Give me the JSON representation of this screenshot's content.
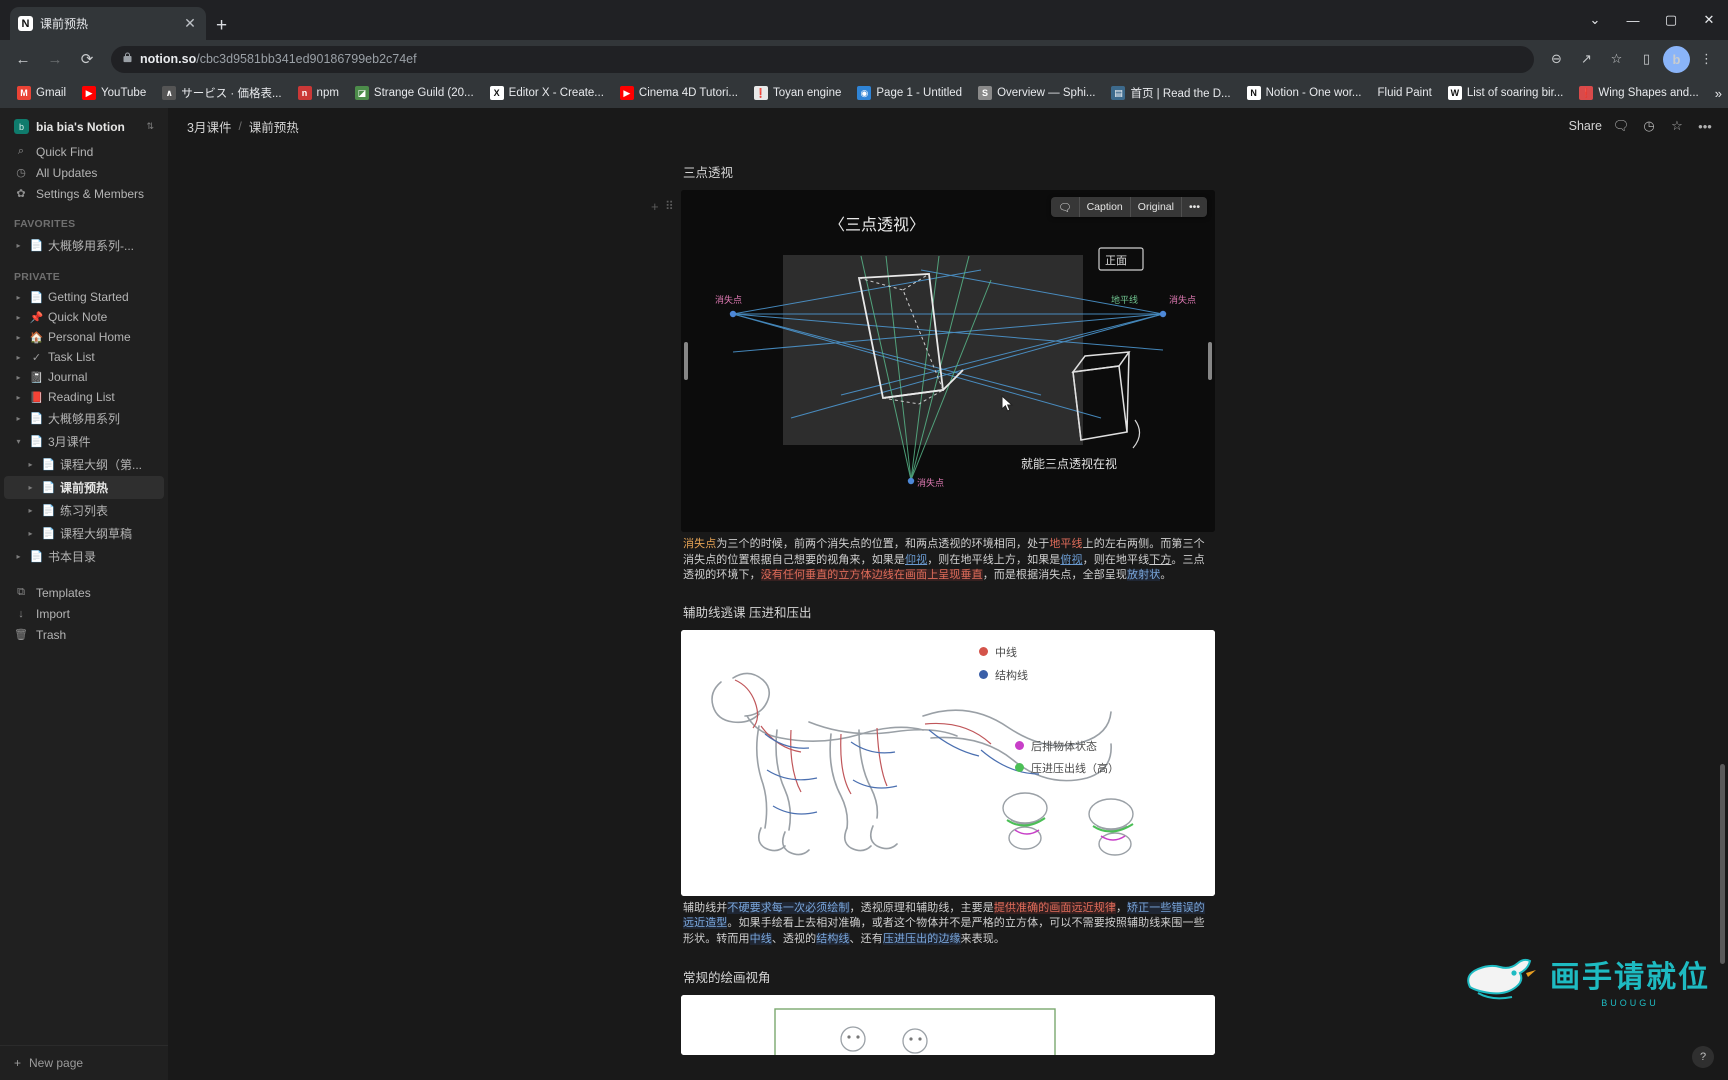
{
  "browser": {
    "tab": {
      "title": "课前预热",
      "favicon": "N",
      "close_label": "✕"
    },
    "new_tab_label": "+",
    "window_controls": {
      "minimize": "—",
      "maximize": "▢",
      "close": "✕",
      "chevron": "⌄"
    },
    "nav": {
      "back": "←",
      "forward": "→",
      "reload": "⟳"
    },
    "omnibox": {
      "lock_icon": "🔒",
      "url_domain": "notion.so",
      "url_path": "/cbc3d9581bb341ed90186799eb2c74ef"
    },
    "toolbar_icons": {
      "zoom": "⊖",
      "share": "↗",
      "star": "☆",
      "sidepanel": "▯",
      "menu": "⋮"
    },
    "profile_initial": "b",
    "bookmarks": [
      {
        "label": "Gmail",
        "icon": "M",
        "color": "#ea4335"
      },
      {
        "label": "YouTube",
        "icon": "▶",
        "color": "#ff0000"
      },
      {
        "label": "サービス · 価格表...",
        "icon": "∧",
        "color": "#555555"
      },
      {
        "label": "npm",
        "icon": "n",
        "color": "#cb3837"
      },
      {
        "label": "Strange Guild (20...",
        "icon": "◪",
        "color": "#4c8c4a"
      },
      {
        "label": "Editor X - Create...",
        "icon": "X",
        "color": "#ffffff"
      },
      {
        "label": "Cinema 4D Tutori...",
        "icon": "▶",
        "color": "#ff0000"
      },
      {
        "label": "Toyan engine",
        "icon": "❗",
        "color": "#e8e8e8"
      },
      {
        "label": "Page 1 - Untitled",
        "icon": "◉",
        "color": "#2f84d6"
      },
      {
        "label": "Overview — Sphi...",
        "icon": "S",
        "color": "#8a8a8a"
      },
      {
        "label": "首页 | Read the D...",
        "icon": "▤",
        "color": "#3d6a8c"
      },
      {
        "label": "Notion - One wor...",
        "icon": "N",
        "color": "#ffffff"
      },
      {
        "label": "Fluid Paint",
        "icon": "",
        "color": "#333333"
      },
      {
        "label": "List of soaring bir...",
        "icon": "W",
        "color": "#ffffff"
      },
      {
        "label": "Wing Shapes and...",
        "icon": "❗",
        "color": "#d94a4a"
      }
    ],
    "bookmarks_overflow": "»"
  },
  "sidebar": {
    "workspace": {
      "name": "bia bia's Notion",
      "icon": "b",
      "chevron": "⇅"
    },
    "quick_rows": [
      {
        "label": "Quick Find",
        "icon": "⌕"
      },
      {
        "label": "All Updates",
        "icon": "◷"
      },
      {
        "label": "Settings & Members",
        "icon": "✿"
      }
    ],
    "favorites_header": "FAVORITES",
    "favorites": [
      {
        "label": "大概够用系列-...",
        "icon": "📄",
        "caret": "▸",
        "level": 1
      }
    ],
    "private_header": "PRIVATE",
    "private": [
      {
        "label": "Getting Started",
        "icon": "📄",
        "caret": "▸",
        "level": 1,
        "active": false
      },
      {
        "label": "Quick Note",
        "icon": "📌",
        "caret": "▸",
        "level": 1,
        "active": false
      },
      {
        "label": "Personal Home",
        "icon": "🏠",
        "caret": "▸",
        "level": 1,
        "active": false
      },
      {
        "label": "Task List",
        "icon": "✓",
        "caret": "▸",
        "level": 1,
        "active": false
      },
      {
        "label": "Journal",
        "icon": "📓",
        "caret": "▸",
        "level": 1,
        "active": false
      },
      {
        "label": "Reading List",
        "icon": "📕",
        "caret": "▸",
        "level": 1,
        "active": false
      },
      {
        "label": "大概够用系列",
        "icon": "📄",
        "caret": "▸",
        "level": 1,
        "active": false
      },
      {
        "label": "3月课件",
        "icon": "📄",
        "caret": "▾",
        "level": 1,
        "active": false
      },
      {
        "label": "课程大纲（第...",
        "icon": "📄",
        "caret": "▸",
        "level": 2,
        "active": false
      },
      {
        "label": "课前预热",
        "icon": "📄",
        "caret": "▸",
        "level": 2,
        "active": true
      },
      {
        "label": "练习列表",
        "icon": "📄",
        "caret": "▸",
        "level": 2,
        "active": false
      },
      {
        "label": "课程大纲草稿",
        "icon": "📄",
        "caret": "▸",
        "level": 2,
        "active": false
      },
      {
        "label": "书本目录",
        "icon": "📄",
        "caret": "▸",
        "level": 1,
        "active": false
      }
    ],
    "bottom_rows": [
      {
        "label": "Templates",
        "icon": "⧉"
      },
      {
        "label": "Import",
        "icon": "↓"
      },
      {
        "label": "Trash",
        "icon": "🗑"
      }
    ],
    "new_page": {
      "label": "New page",
      "icon": "+"
    }
  },
  "topbar": {
    "breadcrumb_parent": "3月课件",
    "breadcrumb_sep": "/",
    "breadcrumb_current": "课前预热",
    "share_label": "Share",
    "icons": {
      "comment": "🗨",
      "updates": "◷",
      "favorite": "☆",
      "more": "•••"
    }
  },
  "document": {
    "blocks": [
      {
        "title": "三点透视",
        "image_kind": "three-point-perspective",
        "toolbar": {
          "comment_icon": "🗨",
          "caption": "Caption",
          "original": "Original",
          "more": "•••"
        },
        "caption_runs": [
          {
            "t": "消失点",
            "c": "hl-o"
          },
          {
            "t": "为三个的时候，前两个消失点的位置，和两点透视的环境相同，处于",
            "c": ""
          },
          {
            "t": "地平线",
            "c": "hl-r"
          },
          {
            "t": "上的左右两侧。而第三个消失点的位置根据自己想要的视角来，如果是",
            "c": ""
          },
          {
            "t": "仰视",
            "c": "hl-b"
          },
          {
            "t": "，则在地平线上方，如果是",
            "c": ""
          },
          {
            "t": "俯视",
            "c": "hl-b"
          },
          {
            "t": "，则在地平线",
            "c": ""
          },
          {
            "t": "下方",
            "c": "hl-u"
          },
          {
            "t": "。三点透视的环境下，",
            "c": ""
          },
          {
            "t": "没有任何垂直的立方体边线在画面上呈现垂直",
            "c": "hl-rb"
          },
          {
            "t": "，而是根据消失点，全部呈现",
            "c": ""
          },
          {
            "t": "放射状",
            "c": "hl-bb"
          },
          {
            "t": "。",
            "c": ""
          }
        ],
        "sketch_labels": {
          "title": "〈三点透视〉",
          "left_vp": "消失点",
          "right_vp_1": "地平线",
          "right_vp_2": "消失点",
          "bottom_vp": "消失点",
          "side_label": "正面",
          "note": "就能三点透视在视"
        }
      },
      {
        "title": "辅助线逃课 压进和压出",
        "image_kind": "dinosaur-guidelines",
        "legend": [
          {
            "label": "中线",
            "color": "#d4544a"
          },
          {
            "label": "结构线",
            "color": "#3b5fa8"
          },
          {
            "label": "后排物体状态",
            "color": "#c83fc8"
          },
          {
            "label": "压进压出线（高）",
            "color": "#4bbf56"
          }
        ],
        "caption_runs": [
          {
            "t": "辅助线并",
            "c": ""
          },
          {
            "t": "不硬要求每一次必须绘制",
            "c": "hl-bb"
          },
          {
            "t": "，透视原理和辅助线，主要是",
            "c": ""
          },
          {
            "t": "提供准确的",
            "c": "hl-rb"
          },
          {
            "t": "画面远近规律",
            "c": "hl-rb"
          },
          {
            "t": "，",
            "c": ""
          },
          {
            "t": "矫正一些错误的远近造型",
            "c": "hl-bb"
          },
          {
            "t": "。如果手绘看上去相对准确，或者这个物体并不是严格的立方体，可以不需要按照辅助线来围一些形状。转而用",
            "c": ""
          },
          {
            "t": "中线",
            "c": "hl-bb"
          },
          {
            "t": "、透视的",
            "c": ""
          },
          {
            "t": "结构线",
            "c": "hl-bb"
          },
          {
            "t": "、还有",
            "c": ""
          },
          {
            "t": "压进压出的边缘",
            "c": "hl-bb"
          },
          {
            "t": "来表现。",
            "c": ""
          }
        ]
      },
      {
        "title": "常规的绘画视角",
        "image_kind": "drawing-angles"
      }
    ]
  },
  "watermark": {
    "text": "画手请就位",
    "sub": "BUOUGU",
    "color": "#1fc4cc"
  },
  "help_button": "?"
}
